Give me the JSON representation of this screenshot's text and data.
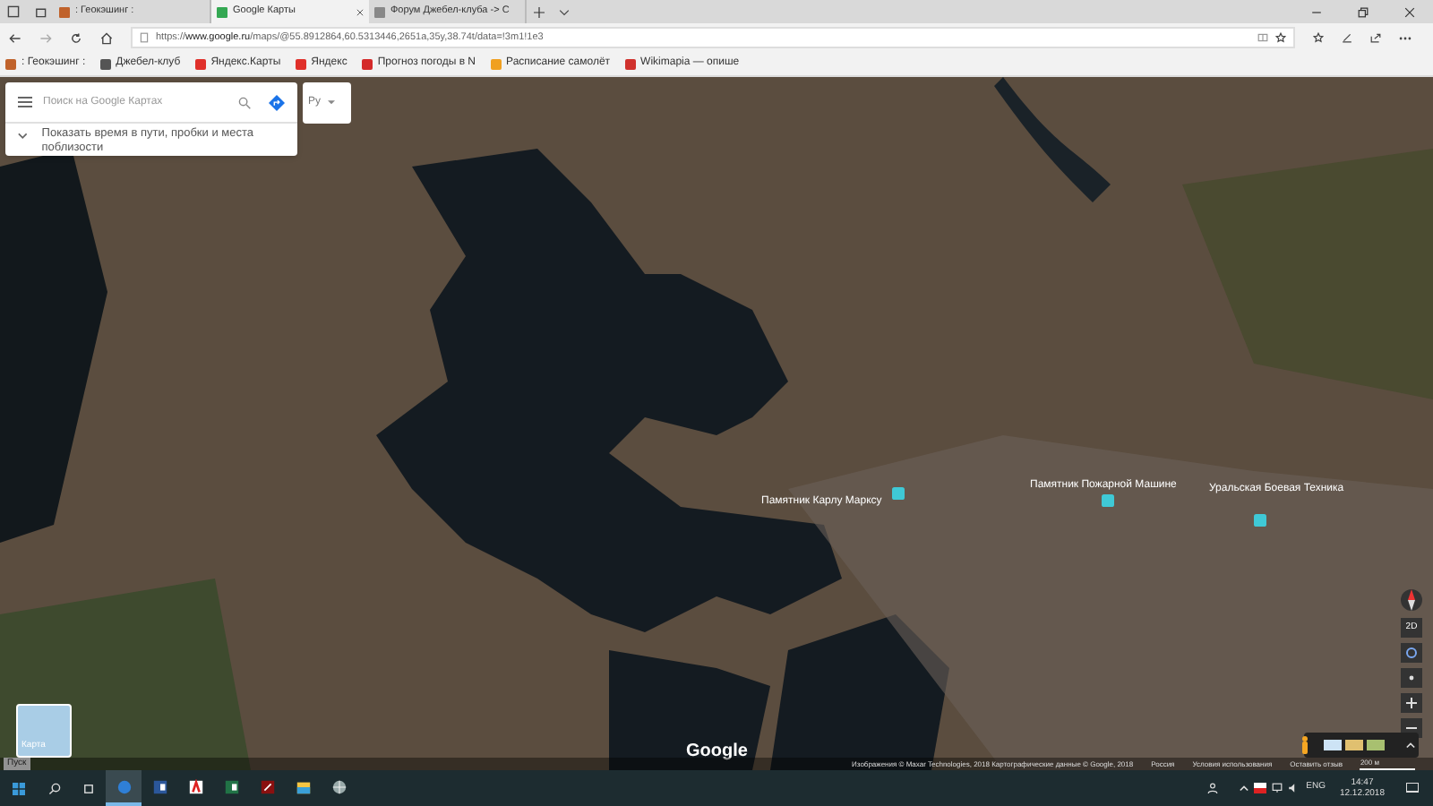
{
  "browser": {
    "tabs": [
      {
        "title": ": Геокэшинг :",
        "selected": false
      },
      {
        "title": "Google Карты",
        "selected": true
      },
      {
        "title": "Форум Джебел-клуба -> С",
        "selected": false
      }
    ],
    "url_prefix": "https://",
    "url_host": "www.google.ru",
    "url_path": "/maps/@55.8912864,60.5313446,2651a,35y,38.74t/data=!3m1!1e3",
    "bookmarks": [
      {
        "label": ": Геокэшинг :",
        "color": "#c0622b"
      },
      {
        "label": "Джебел-клуб",
        "color": "#555555"
      },
      {
        "label": "Яндекс.Карты",
        "color": "#e0302a"
      },
      {
        "label": "Яндекс",
        "color": "#e0302a"
      },
      {
        "label": "Прогноз погоды в N",
        "color": "#d42a2a"
      },
      {
        "label": "Расписание самолёт",
        "color": "#f0a020"
      },
      {
        "label": "Wikimapia — опише",
        "color": "#d0312d"
      }
    ]
  },
  "search": {
    "placeholder": "Поиск на Google Картах",
    "hint": "Показать время в пути, пробки и места поблизости",
    "profile_label": "Ру"
  },
  "map": {
    "places": [
      {
        "text": "Памятник Карлу Марксу"
      },
      {
        "text": "Памятник Пожарной Машине"
      },
      {
        "text": "Уральская Боевая Техника"
      }
    ],
    "logo": "Google",
    "layer_tile": "Карта",
    "view_toggle": "2D",
    "tooltip": "Пуск"
  },
  "footer": {
    "items": [
      "Изображения © Maxar Technologies, 2018 Картографические данные © Google, 2018",
      "Россия",
      "Условия использования",
      "Оставить отзыв"
    ],
    "scale": "200 м"
  },
  "taskbar": {
    "apps": [
      {
        "kind": "edge",
        "active": true
      },
      {
        "kind": "word",
        "active": false
      },
      {
        "kind": "acrobat",
        "active": false
      },
      {
        "kind": "excel",
        "active": false
      },
      {
        "kind": "pdf",
        "active": false
      },
      {
        "kind": "explorer",
        "active": false
      },
      {
        "kind": "globe",
        "active": false
      }
    ],
    "lang": "ENG",
    "time": "14:47",
    "date": "12.12.2018"
  }
}
